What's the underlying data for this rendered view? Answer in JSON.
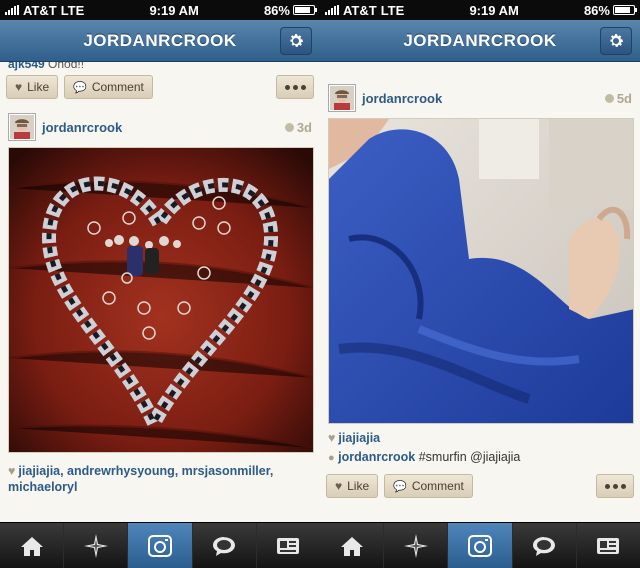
{
  "status": {
    "carrier": "AT&T",
    "network": "LTE",
    "time": "9:19 AM",
    "battery": "86%",
    "battery_level": 0.86
  },
  "header": {
    "title": "JORDANRCROOK"
  },
  "left": {
    "prev_comment": {
      "user": "ajk549",
      "text": "Ohod!!"
    },
    "like_label": "Like",
    "comment_label": "Comment",
    "post": {
      "username": "jordanrcrook",
      "time": "3d",
      "likes": "jiajiajia, andrewrhysyoung, mrsjasonmiller, michaeloryl"
    }
  },
  "right": {
    "post": {
      "username": "jordanrcrook",
      "time": "5d",
      "likes": "jiajiajia",
      "caption_user": "jordanrcrook",
      "caption_text": "#smurfin @jiajiajia"
    },
    "like_label": "Like",
    "comment_label": "Comment"
  },
  "tabs": [
    "home-icon",
    "explore-icon",
    "camera-icon",
    "news-icon",
    "profile-icon"
  ],
  "colors": {
    "nav": "#3b6a96",
    "username": "#2d5a86",
    "tab_active": "#3f75aa"
  }
}
